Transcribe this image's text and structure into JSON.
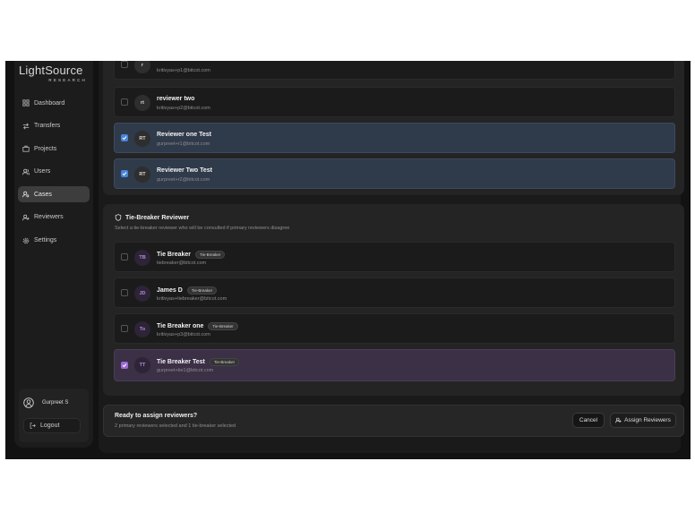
{
  "brand": {
    "name": "LightSource",
    "tagline": "RESEARCH"
  },
  "sidebar": {
    "items": [
      {
        "label": "Dashboard",
        "icon": "grid-icon",
        "active": false
      },
      {
        "label": "Transfers",
        "icon": "arrows-icon",
        "active": false
      },
      {
        "label": "Projects",
        "icon": "briefcase-icon",
        "active": false
      },
      {
        "label": "Users",
        "icon": "users-icon",
        "active": false
      },
      {
        "label": "Cases",
        "icon": "user-search-icon",
        "active": true
      },
      {
        "label": "Reviewers",
        "icon": "user-plus-icon",
        "active": false
      },
      {
        "label": "Settings",
        "icon": "gear-icon",
        "active": false
      }
    ],
    "user": {
      "name": "Gurpreet S"
    },
    "logout_label": "Logout"
  },
  "primary_reviewers": [
    {
      "initials": "r",
      "name": "",
      "email": "kritivyas+p1@bitcot.com",
      "checked": false
    },
    {
      "initials": "rt",
      "name": "reviewer two",
      "email": "kritivyas+p2@bitcot.com",
      "checked": false
    },
    {
      "initials": "RT",
      "name": "Reviewer one Test",
      "email": "gurpreet+r1@bitcot.com",
      "checked": true
    },
    {
      "initials": "RT",
      "name": "Reviewer Two Test",
      "email": "gurpreet+r2@bitcot.com",
      "checked": true
    }
  ],
  "tie_breaker": {
    "title": "Tie-Breaker Reviewer",
    "description": "Select a tie-breaker reviewer who will be consulted if primary reviewers disagree",
    "badge": "Tie-Breaker",
    "reviewers": [
      {
        "initials": "TB",
        "name": "Tie Breaker",
        "email": "tiebreaker@bitcot.com",
        "checked": false
      },
      {
        "initials": "JD",
        "name": "James D",
        "email": "kritivyas+tiebreaker@bitcot.com",
        "checked": false
      },
      {
        "initials": "To",
        "name": "Tie Breaker one",
        "email": "kritivyas+p3@bitcot.com",
        "checked": false
      },
      {
        "initials": "TT",
        "name": "Tie Breaker Test",
        "email": "gurpreet+tie1@bitcot.com",
        "checked": true
      }
    ]
  },
  "footer": {
    "title": "Ready to assign reviewers?",
    "subtitle": "2 primary reviewers selected and 1 tie-breaker selected",
    "cancel_label": "Cancel",
    "assign_label": "Assign Reviewers"
  },
  "colors": {
    "primary_selected": "#2f3a4a",
    "tiebreaker_selected": "#3b3046",
    "check_blue": "#4a84d8",
    "check_purple": "#9a6bd6"
  }
}
